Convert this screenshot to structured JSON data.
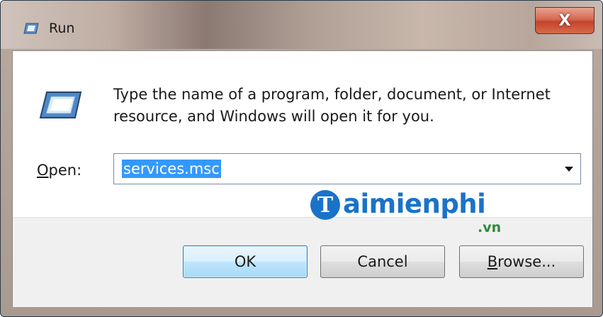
{
  "window": {
    "title": "Run",
    "close_label": "X"
  },
  "dialog": {
    "description_line1": "Type the name of a program, folder, document, or Internet",
    "description_line2": "resource, and Windows will open it for you.",
    "open_label_accel": "O",
    "open_label_rest": "pen:",
    "open_value": "services.msc"
  },
  "watermark": {
    "initial": "T",
    "name": "aimienphi",
    "suffix": ".vn"
  },
  "buttons": {
    "ok_label": "OK",
    "cancel_label": "Cancel",
    "browse_accel": "B",
    "browse_rest": "rowse..."
  },
  "colors": {
    "selection": "#3399ff",
    "watermark_blue": "#1a73c9",
    "watermark_green": "#2e8b3a",
    "close_red": "#c3452c"
  },
  "icons": {
    "title": "run-icon",
    "body": "run-icon",
    "close": "close-icon",
    "dropdown": "chevron-down-icon"
  }
}
